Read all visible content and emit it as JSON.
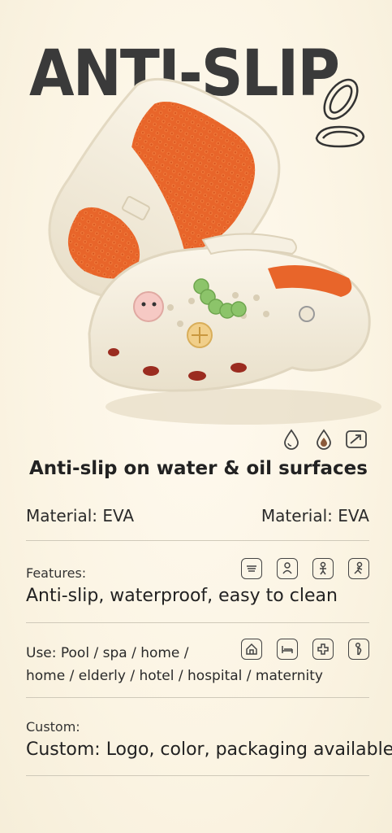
{
  "headline": "ANTI-SLIP",
  "tagline": "Anti-slip on water & oil surfaces",
  "material": {
    "left": "Material: EVA",
    "right": "Material: EVA"
  },
  "features": {
    "label": "Features:",
    "text": "Anti-slip, waterproof, easy to clean",
    "icons": [
      "shower-icon",
      "person-icon",
      "elderly-icon",
      "walking-icon"
    ]
  },
  "use": {
    "line1": "Use: Pool / spa / home /",
    "line2": "home / elderly / hotel / hospital / maternity",
    "icons": [
      "home-icon",
      "bed-icon",
      "hospital-cross-icon",
      "pregnant-icon"
    ]
  },
  "custom": {
    "label": "Custom:",
    "text": "Custom: Logo, color, packaging available"
  },
  "hero_icons": [
    "water-drop-icon",
    "oil-drop-icon",
    "slip-arrow-icon"
  ],
  "colors": {
    "background": "#fbf5e6",
    "sole": "#e8652a",
    "shoe": "#f3ecdc",
    "text": "#2a2a2a"
  }
}
